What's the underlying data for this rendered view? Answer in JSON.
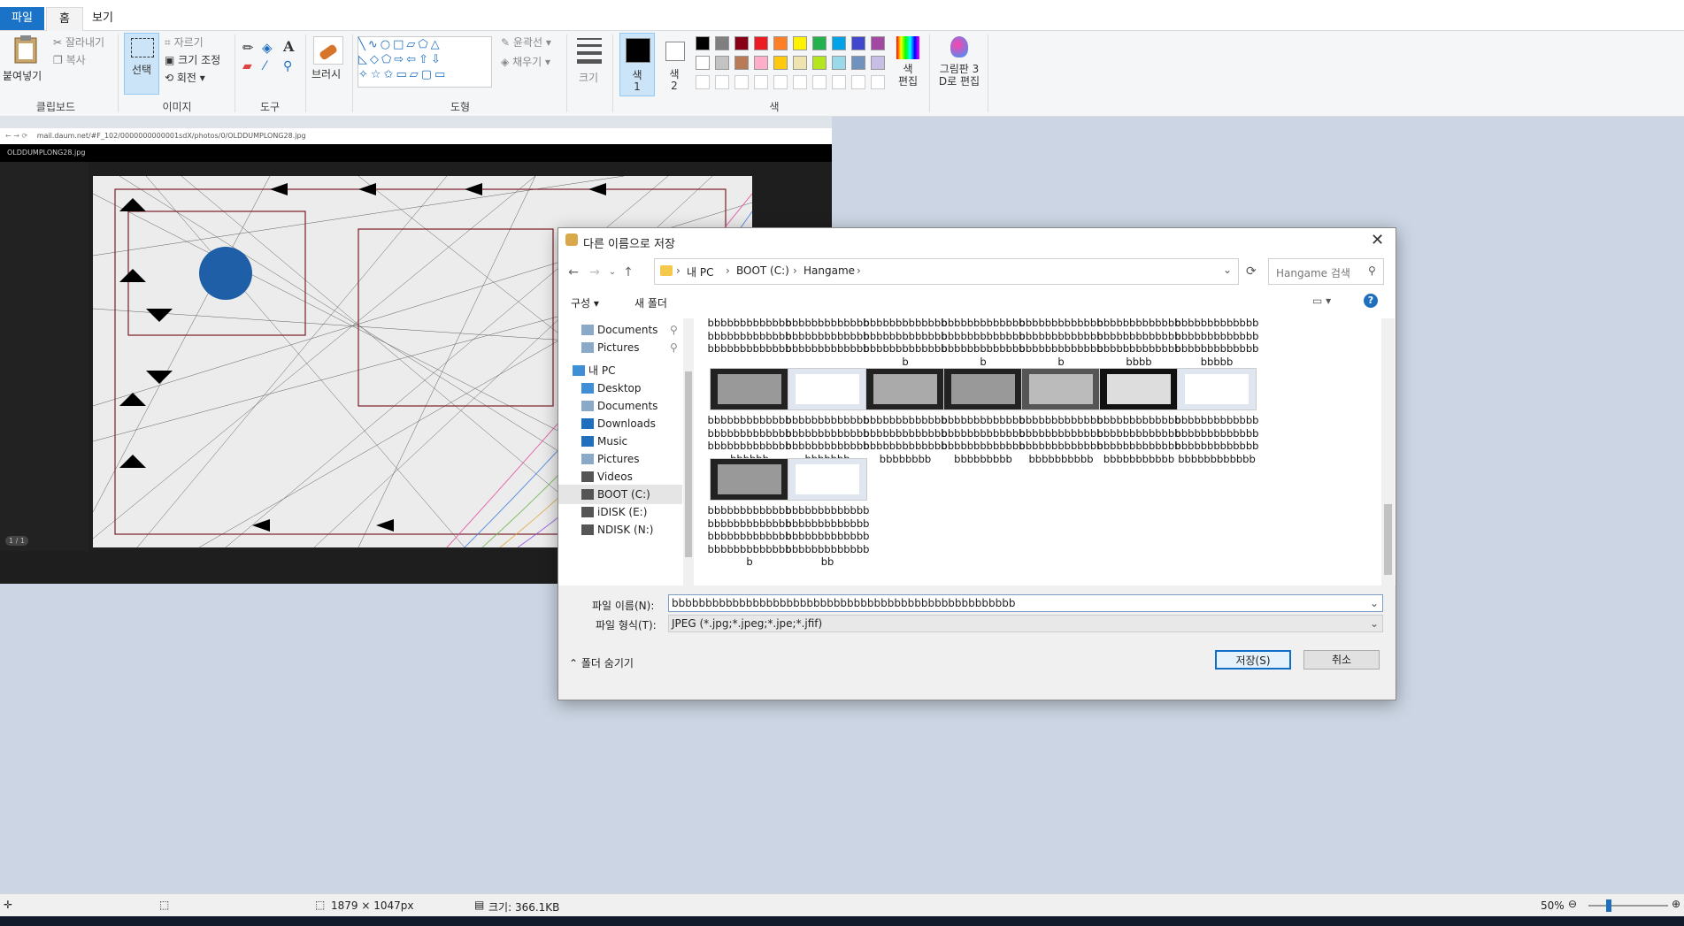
{
  "ribbon": {
    "tabs": {
      "file": "파일",
      "home": "홈",
      "view": "보기"
    },
    "clipboard": {
      "paste": "붙여넣기",
      "cut": "잘라내기",
      "copy": "복사",
      "label": "클립보드"
    },
    "image": {
      "select": "선택",
      "crop": "자르기",
      "resize": "크기 조정",
      "rotate": "회전",
      "label": "이미지"
    },
    "tools": {
      "label": "도구"
    },
    "brushes": {
      "label": "브러시"
    },
    "shapes": {
      "outline": "윤곽선",
      "fill": "채우기",
      "label": "도형"
    },
    "size": {
      "label": "크기"
    },
    "color1": {
      "label1": "색",
      "label2": "1"
    },
    "color2": {
      "label1": "색",
      "label2": "2"
    },
    "colors": {
      "label": "색",
      "edit1": "색",
      "edit2": "편집"
    },
    "paint3d": {
      "line1": "그림판 3",
      "line2": "D로 편집"
    },
    "palette_row1": [
      "#000000",
      "#7f7f7f",
      "#880015",
      "#ed1c24",
      "#ff7f27",
      "#fff200",
      "#22b14c",
      "#00a2e8",
      "#3f48cc",
      "#a349a4"
    ],
    "palette_row2": [
      "#ffffff",
      "#c3c3c3",
      "#b97a57",
      "#ffaec9",
      "#ffc90e",
      "#efe4b0",
      "#b5e61d",
      "#99d9ea",
      "#7092be",
      "#c8bfe7"
    ]
  },
  "canvas": {
    "url": "mail.daum.net/#F_102/0000000000001sdX/photos/0/OLDDUMPLONG28.jpg",
    "viewer_title": "OLDDUMPLONG28.jpg",
    "page_indicator": "1 / 1"
  },
  "dialog": {
    "title": "다른 이름으로 저장",
    "breadcrumb": [
      "내 PC",
      "BOOT (C:)",
      "Hangame"
    ],
    "search_placeholder": "Hangame 검색",
    "organize": "구성",
    "new_folder": "새 폴더",
    "nav": [
      {
        "label": "Documents",
        "pinned": true
      },
      {
        "label": "Pictures",
        "pinned": true
      },
      {
        "label": "내 PC",
        "pinned": false
      },
      {
        "label": "Desktop",
        "pinned": false
      },
      {
        "label": "Documents",
        "pinned": false
      },
      {
        "label": "Downloads",
        "pinned": false
      },
      {
        "label": "Music",
        "pinned": false
      },
      {
        "label": "Pictures",
        "pinned": false
      },
      {
        "label": "Videos",
        "pinned": false
      },
      {
        "label": "BOOT (C:)",
        "pinned": false
      },
      {
        "label": "iDISK (E:)",
        "pinned": false
      },
      {
        "label": "NDISK (N:)",
        "pinned": false
      }
    ],
    "row1_names": [
      "bbbbbbbbbbbbbbbbbbbbbbbbbbbbbbbbbbbbbbb",
      "bbbbbbbbbbbbbbbbbbbbbbbbbbbbbbbbbbbbbbb",
      "bbbbbbbbbbbbbbbbbbbbbbbbbbbbbbbbbbbbbbbb",
      "bbbbbbbbbbbbbbbbbbbbbbbbbbbbbbbbbbbbbbbb",
      "bbbbbbbbbbbbbbbbbbbbbbbbbbbbbbbbbbbbbbbb",
      "bbbbbbbbbbbbbbbbbbbbbbbbbbbbbbbbbbbbbbbbbbb",
      "bbbbbbbbbbbbbbbbbbbbbbbbbbbbbbbbbbbbbbbbbbbb"
    ],
    "row2_names": [
      "bbbbbbbbbbbbbbbbbbbbbbbbbbbbbbbbbbbbbbbbbbbbb",
      "bbbbbbbbbbbbbbbbbbbbbbbbbbbbbbbbbbbbbbbbbbbbbb",
      "bbbbbbbbbbbbbbbbbbbbbbbbbbbbbbbbbbbbbbbbbbbbbbb",
      "bbbbbbbbbbbbbbbbbbbbbbbbbbbbbbbbbbbbbbbbbbbbbbbb",
      "bbbbbbbbbbbbbbbbbbbbbbbbbbbbbbbbbbbbbbbbbbbbbbbbb",
      "bbbbbbbbbbbbbbbbbbbbbbbbbbbbbbbbbbbbbbbbbbbbbbbbbb",
      "bbbbbbbbbbbbbbbbbbbbbbbbbbbbbbbbbbbbbbbbbbbbbbbbbbb"
    ],
    "row3_names": [
      "bbbbbbbbbbbbbbbbbbbbbbbbbbbbbbbbbbbbbbbbbbbbbbbbbbbbb",
      "bbbbbbbbbbbbbbbbbbbbbbbbbbbbbbbbbbbbbbbbbbbbbbbbbbbbbb"
    ],
    "filename_label": "파일 이름(N):",
    "filename_value": "bbbbbbbbbbbbbbbbbbbbbbbbbbbbbbbbbbbbbbbbbbbbbbbbbbb",
    "filetype_label": "파일 형식(T):",
    "filetype_value": "JPEG (*.jpg;*.jpeg;*.jpe;*.jfif)",
    "hide_folders": "폴더 숨기기",
    "save": "저장(S)",
    "cancel": "취소"
  },
  "status": {
    "dimensions": "1879 × 1047px",
    "size": "크기: 366.1KB",
    "zoom": "50%"
  }
}
